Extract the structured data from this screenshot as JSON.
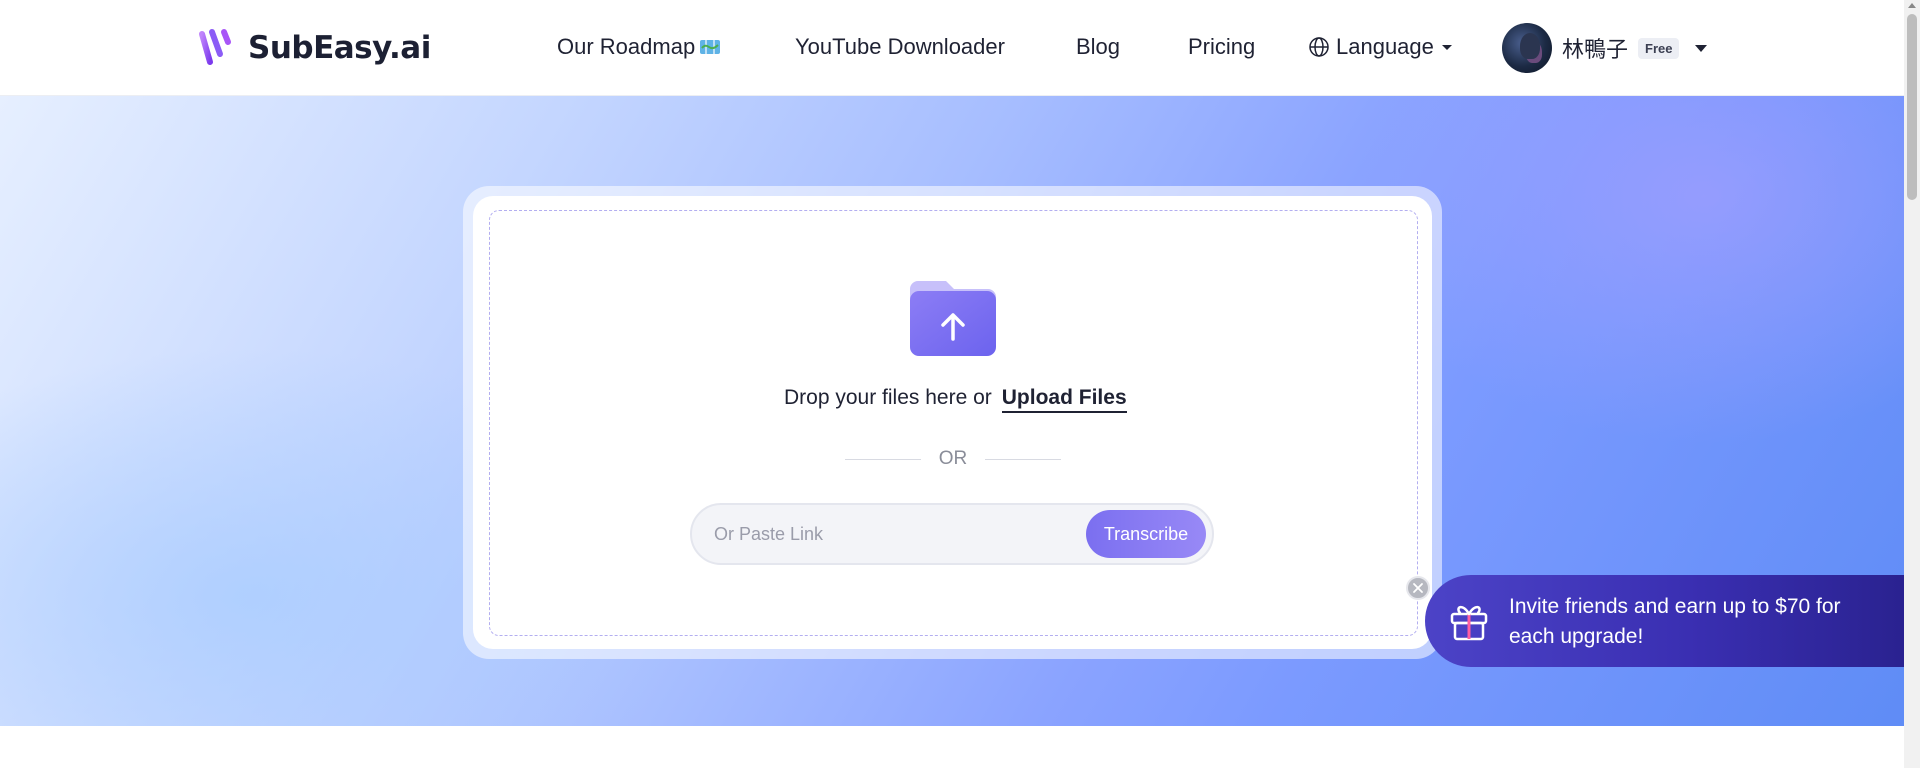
{
  "brand": {
    "name": "SubEasy.ai",
    "accent": "#7b6ff0"
  },
  "nav": {
    "roadmap": "Our Roadmap",
    "youtube": "YouTube Downloader",
    "blog": "Blog",
    "pricing": "Pricing",
    "language": "Language"
  },
  "user": {
    "name": "林鴨子",
    "plan": "Free"
  },
  "upload": {
    "drop_text": "Drop your files here or",
    "upload_link": "Upload Files",
    "or_text": "OR",
    "paste_placeholder": "Or Paste Link",
    "transcribe_label": "Transcribe"
  },
  "invite": {
    "text": "Invite friends and earn up to $70 for each upgrade!",
    "color": "#3a2fb2"
  },
  "icons": [
    "logo-mark-icon",
    "map-icon",
    "globe-icon",
    "chevron-down-icon",
    "folder-upload-icon",
    "close-icon",
    "gift-icon"
  ]
}
